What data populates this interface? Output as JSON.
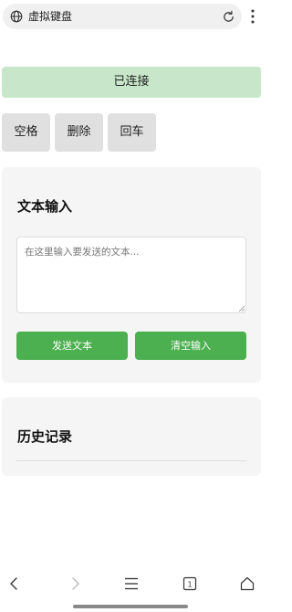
{
  "browser": {
    "url_text": "虚拟键盘",
    "icons": {
      "left": "globe-icon",
      "reload": "reload-icon",
      "menu": "more-vert-icon"
    }
  },
  "status": {
    "label": "已连接",
    "color": "#c8e6c9"
  },
  "keys": [
    {
      "label": "空格"
    },
    {
      "label": "删除"
    },
    {
      "label": "回车"
    }
  ],
  "text_input": {
    "title": "文本输入",
    "placeholder": "在这里输入要发送的文本...",
    "value": "",
    "send_label": "发送文本",
    "clear_label": "清空输入",
    "button_color": "#4caf50"
  },
  "history": {
    "title": "历史记录",
    "items": []
  },
  "bottom_nav": {
    "icons": [
      "back-icon",
      "forward-icon",
      "menu-icon",
      "tabs-icon",
      "home-icon"
    ],
    "tab_count": "1"
  }
}
